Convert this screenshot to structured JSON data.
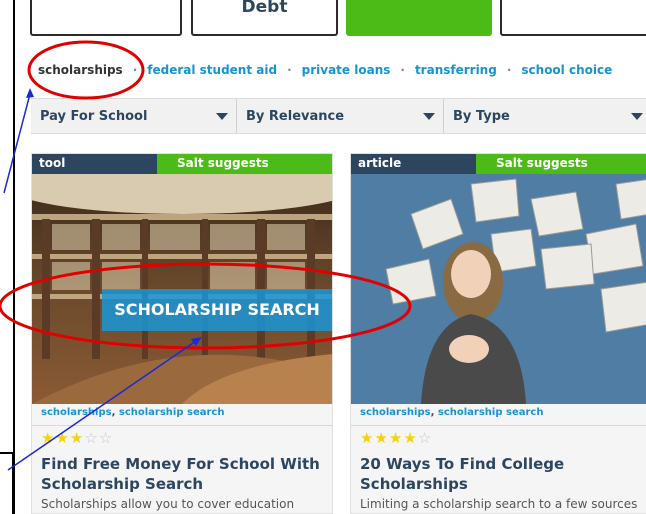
{
  "nav": {
    "tabs": [
      "",
      "Debt",
      "",
      ""
    ]
  },
  "topics": {
    "active": "scholarships",
    "links": [
      "federal student aid",
      "private loans",
      "transferring",
      "school choice"
    ]
  },
  "filters": [
    {
      "label": "Pay For School"
    },
    {
      "label": "By Relevance"
    },
    {
      "label": "By Type"
    }
  ],
  "cards": [
    {
      "type": "tool",
      "badge": "Salt suggests",
      "banner": "SCHOLARSHIP SEARCH",
      "tags": [
        "scholarships",
        "scholarship search"
      ],
      "rating": 3,
      "title": "Find Free Money For School With Scholarship Search",
      "desc": "Scholarships allow you to cover education"
    },
    {
      "type": "article",
      "badge": "Salt suggests",
      "tags": [
        "scholarships",
        "scholarship search"
      ],
      "rating": 4,
      "title": "20 Ways To Find College Scholarships",
      "desc": "Limiting a scholarship search to a few sources"
    }
  ],
  "colors": {
    "brand_navy": "#2d4660",
    "brand_green": "#4cbb17",
    "link_blue": "#1793cf",
    "annotation_red": "#e00000",
    "annotation_blue": "#1a2bd6"
  },
  "icons": [
    "caret-down-icon",
    "star-icon"
  ]
}
